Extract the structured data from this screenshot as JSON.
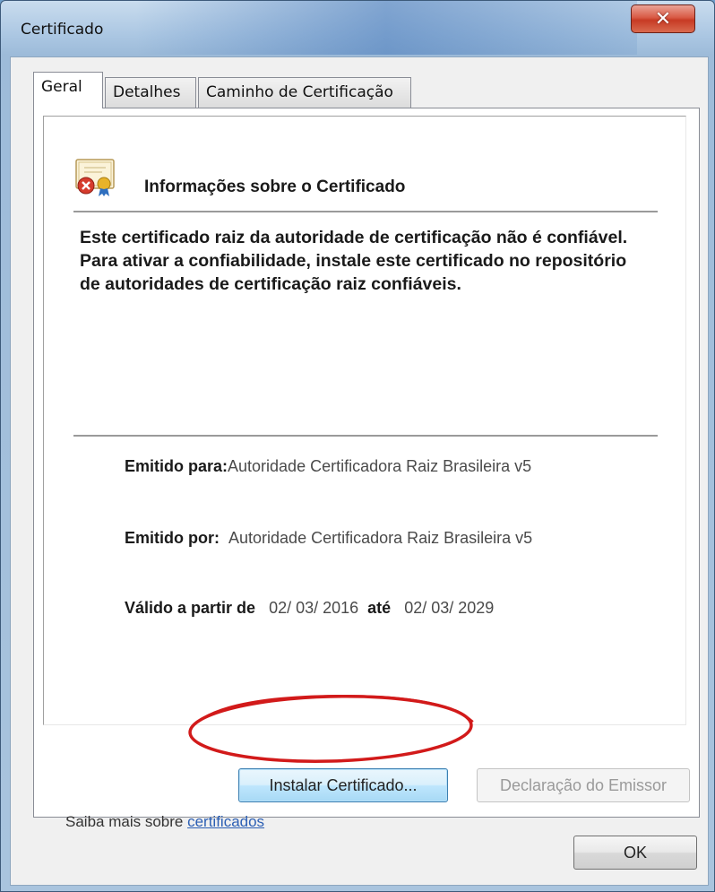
{
  "window": {
    "title": "Certificado",
    "close_glyph": "✕"
  },
  "tabs": [
    {
      "label": "Geral",
      "active": true
    },
    {
      "label": "Detalhes",
      "active": false
    },
    {
      "label": "Caminho de Certificação",
      "active": false
    }
  ],
  "general": {
    "icon": "certificate-error-icon",
    "heading": "Informações sobre o Certificado",
    "warning": "Este certificado raiz da autoridade de certificação não é confiável. Para ativar a confiabilidade, instale este certificado no repositório de autoridades de certificação raiz confiáveis.",
    "issued_to_label": "Emitido para:",
    "issued_to_value": "Autoridade Certificadora Raiz Brasileira v5",
    "issued_by_label": "Emitido por:",
    "issued_by_value": "Autoridade Certificadora Raiz Brasileira v5",
    "valid_from_label": "Válido a partir de",
    "valid_from_value": "02/ 03/ 2016",
    "valid_to_label": "até",
    "valid_to_value": "02/ 03/ 2029"
  },
  "buttons": {
    "install": "Instalar Certificado...",
    "issuer_statement": "Declaração do Emissor",
    "ok": "OK"
  },
  "learn_more": {
    "prefix": "Saiba mais sobre",
    "link": "certificados"
  },
  "colors": {
    "annotation": "#d21a1a",
    "link": "#2c5fb4",
    "close_button": "#c73a24"
  }
}
